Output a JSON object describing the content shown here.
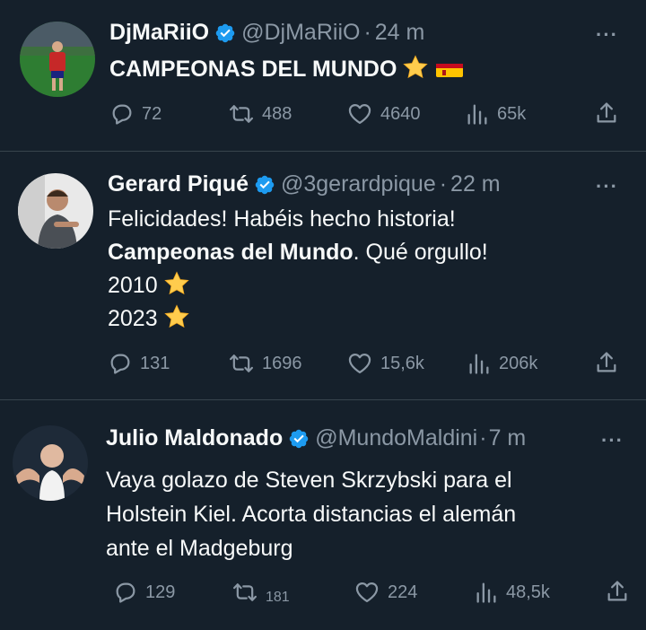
{
  "tweets": [
    {
      "name": "DjMaRiiO",
      "handle": "@DjMaRiiO",
      "sep": "·",
      "time": "24 m",
      "more": "···",
      "lines": [
        "CAMPEONAS DEL MUNDO"
      ],
      "actions": {
        "replies": "72",
        "retweets": "488",
        "likes": "4640",
        "views": "65k"
      }
    },
    {
      "name": "Gerard Piqué",
      "handle": "@3gerardpique",
      "sep": "·",
      "time": "22 m",
      "more": "···",
      "line1": "Felicidades! Habéis hecho historia!",
      "line2_bold": "Campeonas del Mundo",
      "line2_rest": ". Qué orgullo!",
      "line3": "2010",
      "line4": "2023",
      "actions": {
        "replies": "131",
        "retweets": "1696",
        "likes": "15,6k",
        "views": "206k"
      }
    },
    {
      "name": "Julio Maldonado",
      "handle": "@MundoMaldini",
      "sep": "·",
      "time": "7 m",
      "more": "···",
      "lines": [
        "Vaya golazo de Steven Skrzybski para el",
        "Holstein Kiel. Acorta distancias el alemán",
        "ante el Madgeburg"
      ],
      "actions": {
        "replies": "129",
        "retweets": "181",
        "likes": "224",
        "views": "48,5k"
      }
    }
  ],
  "colors": {
    "background": "#15202b",
    "muted": "#8b98a5",
    "verified": "#1d9bf0",
    "divider": "#38444d"
  }
}
